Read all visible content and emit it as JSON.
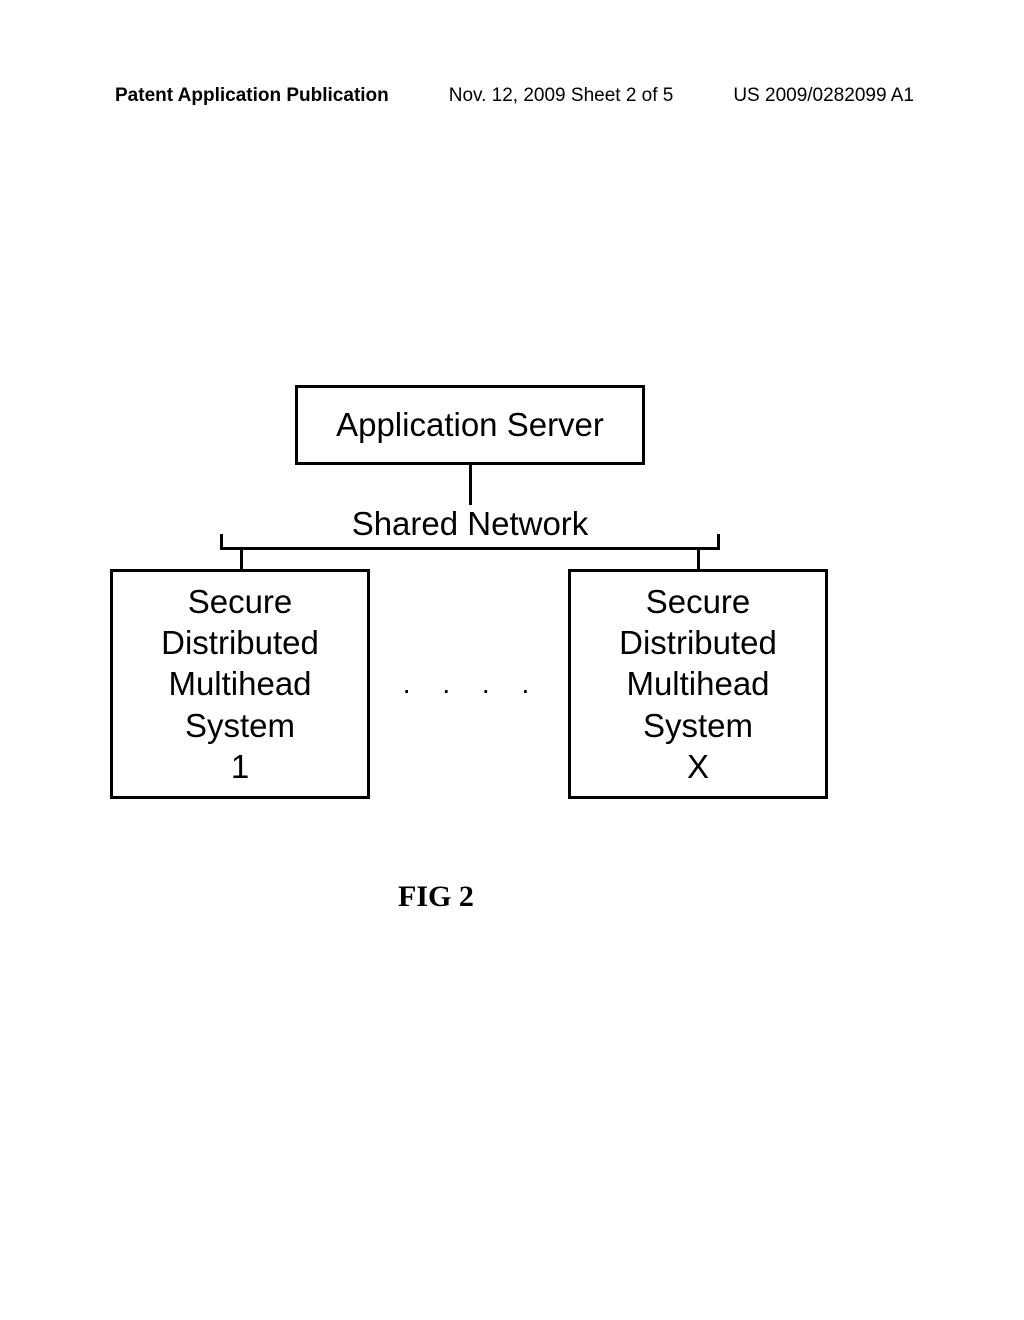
{
  "header": {
    "left": "Patent Application Publication",
    "center": "Nov. 12, 2009  Sheet 2 of 5",
    "right": "US 2009/0282099 A1"
  },
  "diagram": {
    "app_server": "Application Server",
    "shared_network": "Shared Network",
    "box_left_line1": "Secure",
    "box_left_line2": "Distributed",
    "box_left_line3": "Multihead",
    "box_left_line4": "System",
    "box_left_line5": "1",
    "box_right_line1": "Secure",
    "box_right_line2": "Distributed",
    "box_right_line3": "Multihead",
    "box_right_line4": "System",
    "box_right_line5": "X",
    "dots": ". . . .",
    "figure_label": "FIG 2"
  }
}
